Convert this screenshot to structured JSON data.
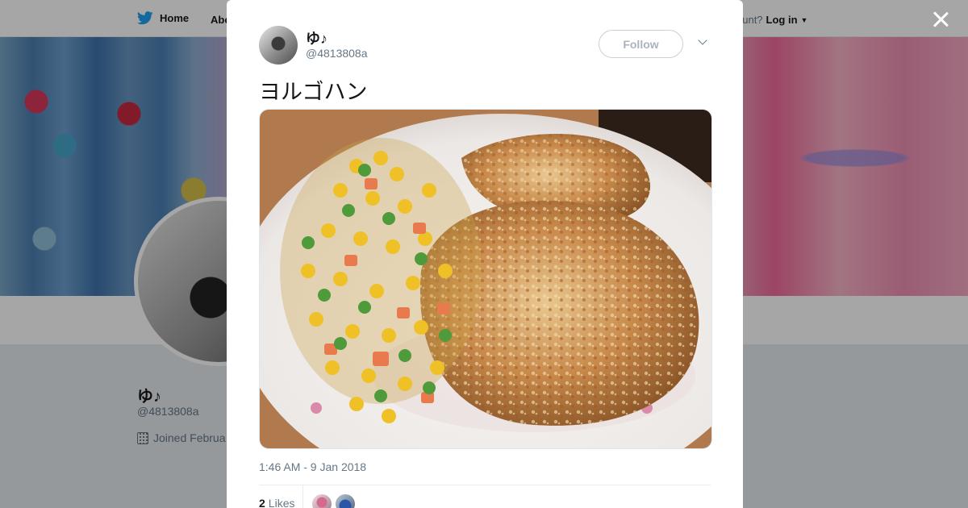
{
  "background_page": {
    "nav": {
      "home_label": "Home",
      "about_label": "Abo",
      "account_question": "ccount?",
      "login_label": "Log in"
    },
    "profile": {
      "name": "ゆ♪",
      "handle": "@4813808a",
      "joined": "Joined Februa"
    }
  },
  "tweet": {
    "author_name": "ゆ♪",
    "author_handle": "@4813808a",
    "follow_label": "Follow",
    "text": "ヨルゴハン",
    "timestamp": "1:46 AM - 9 Jan 2018",
    "likes_count": "2",
    "likes_label": "Likes"
  },
  "icons": {
    "close": "close-icon",
    "bird": "twitter-bird-icon",
    "caret": "chevron-down-icon",
    "calendar": "calendar-icon"
  },
  "colors": {
    "brand": "#1da1f2",
    "text": "#14171a",
    "secondary": "#657786",
    "background": "#e6ecf0"
  }
}
